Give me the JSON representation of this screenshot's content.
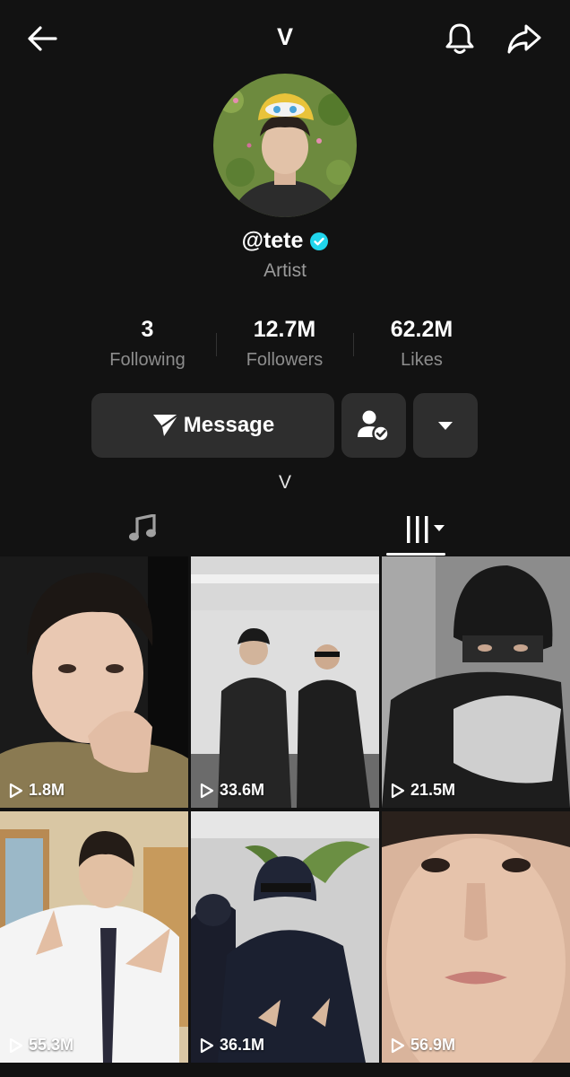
{
  "header": {
    "title": "V",
    "icons": [
      "arrow-left-icon",
      "bell-icon",
      "share-icon"
    ]
  },
  "profile": {
    "handle": "@tete",
    "verified": true,
    "category": "Artist",
    "bio": "V"
  },
  "stats": [
    {
      "value": "3",
      "label": "Following"
    },
    {
      "value": "12.7M",
      "label": "Followers"
    },
    {
      "value": "62.2M",
      "label": "Likes"
    }
  ],
  "actions": {
    "message_label": "Message",
    "icons": [
      "send-icon",
      "friends-icon",
      "caret-down-icon"
    ]
  },
  "tabs": {
    "icons": [
      "music-note-icon",
      "video-grid-icon"
    ],
    "active": "videos"
  },
  "videos": [
    {
      "views": "1.8M"
    },
    {
      "views": "33.6M"
    },
    {
      "views": "21.5M"
    },
    {
      "views": "55.3M"
    },
    {
      "views": "36.1M"
    },
    {
      "views": "56.9M"
    }
  ],
  "colors": {
    "background": "#121212",
    "button": "#2e2e2e",
    "verified": "#20d5ec",
    "muted_text": "#8d8d8d"
  }
}
